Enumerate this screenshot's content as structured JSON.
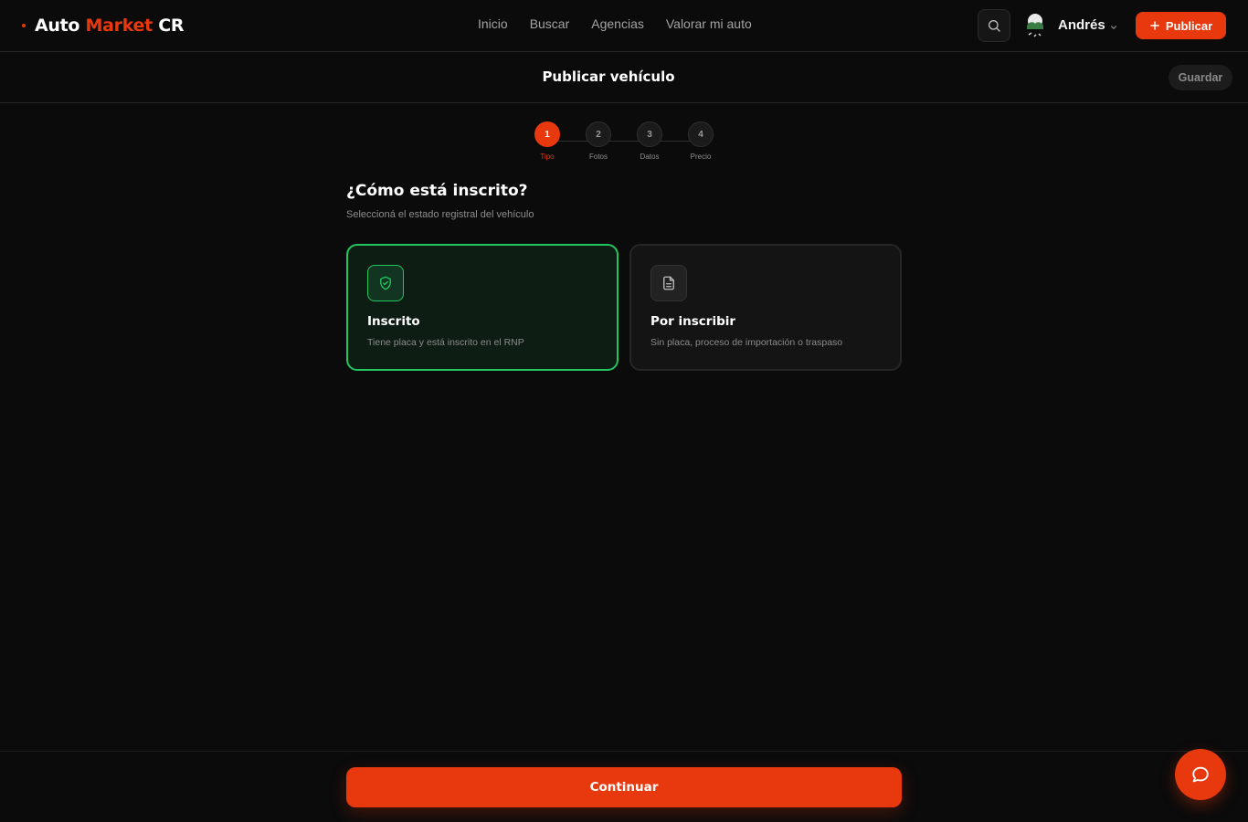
{
  "brand": {
    "name_part1": "Auto",
    "name_part2": "Market",
    "name_part3": "CR"
  },
  "nav": {
    "links": [
      "Inicio",
      "Buscar",
      "Agencias",
      "Valorar mi auto"
    ]
  },
  "user": {
    "name": "Andrés"
  },
  "header": {
    "publish_label": "Publicar"
  },
  "subheader": {
    "title": "Publicar vehículo",
    "save_label": "Guardar"
  },
  "stepper": {
    "steps": [
      {
        "number": "1",
        "label": "Tipo",
        "active": true
      },
      {
        "number": "2",
        "label": "Fotos",
        "active": false
      },
      {
        "number": "3",
        "label": "Datos",
        "active": false
      },
      {
        "number": "4",
        "label": "Precio",
        "active": false
      }
    ]
  },
  "question": {
    "title": "¿Cómo está inscrito?",
    "subtitle": "Seleccioná el estado registral del vehículo"
  },
  "options": [
    {
      "title": "Inscrito",
      "description": "Tiene placa y está inscrito en el RNP",
      "icon": "shield-check-icon",
      "selected": true
    },
    {
      "title": "Por inscribir",
      "description": "Sin placa, proceso de importación o traspaso",
      "icon": "document-icon",
      "selected": false
    }
  ],
  "footer": {
    "continue_label": "Continuar"
  },
  "colors": {
    "accent": "#e8390e",
    "selected": "#22c55e",
    "background": "#0b0b0b"
  }
}
